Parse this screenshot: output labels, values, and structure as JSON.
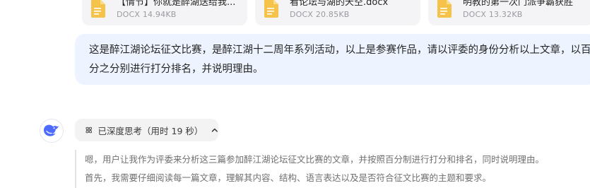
{
  "attachments": [
    {
      "name": "【情节】你就是醉湖送给我...",
      "meta": "DOCX 14.94KB",
      "icon": "docx-file-icon"
    },
    {
      "name": "看论坛与湖的天空.docx",
      "meta": "DOCX 20.85KB",
      "icon": "docx-file-icon"
    },
    {
      "name": "明教的第一次门派争霸获胜",
      "meta": "DOCX 13.32KB",
      "icon": "docx-file-icon"
    }
  ],
  "user_message": "这是醉江湖论坛征文比赛，是醉江湖十二周年系列活动，以上是参赛作品，请以评委的身份分析以上文章，以百分之分别进行打分排名，并说明理由。",
  "assistant": {
    "thinking_label": "已深度思考（用时 19 秒）",
    "reasoning_lines": [
      "嗯，用户让我作为评委来分析这三篇参加醉江湖论坛征文比赛的文章，并按照百分制进行打分和排名，同时说明理由。",
      "首先，我需要仔细阅读每一篇文章，理解其内容、结构、语言表达以及是否符合征文比赛的主题和要求。"
    ]
  },
  "colors": {
    "file_icon": "#f5c24a",
    "bubble_bg": "#eef4ff",
    "brand_blue": "#4d6bfe"
  }
}
